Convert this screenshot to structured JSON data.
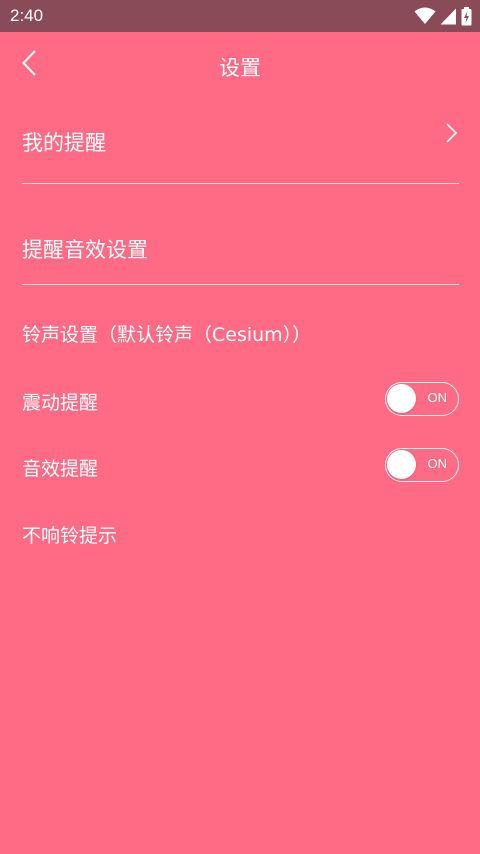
{
  "status_bar": {
    "time": "2:40"
  },
  "header": {
    "title": "设置"
  },
  "items": {
    "my_reminder": "我的提醒",
    "reminder_sound_settings": "提醒音效设置",
    "ringtone_settings": "铃声设置（默认铃声（Cesium））",
    "vibration_reminder": "震动提醒",
    "sound_reminder": "音效提醒",
    "no_ring_prompt": "不响铃提示"
  },
  "toggles": {
    "vibration": {
      "text": "ON",
      "state": "off"
    },
    "sound": {
      "text": "ON",
      "state": "off"
    }
  },
  "icons": {
    "back": "chevron-left-icon",
    "forward": "chevron-right-icon",
    "wifi": "wifi-icon",
    "signal": "signal-icon",
    "battery": "battery-charging-icon"
  },
  "colors": {
    "background": "#ff6b84",
    "status_bar": "#8a4b58",
    "text": "#ffffff"
  }
}
